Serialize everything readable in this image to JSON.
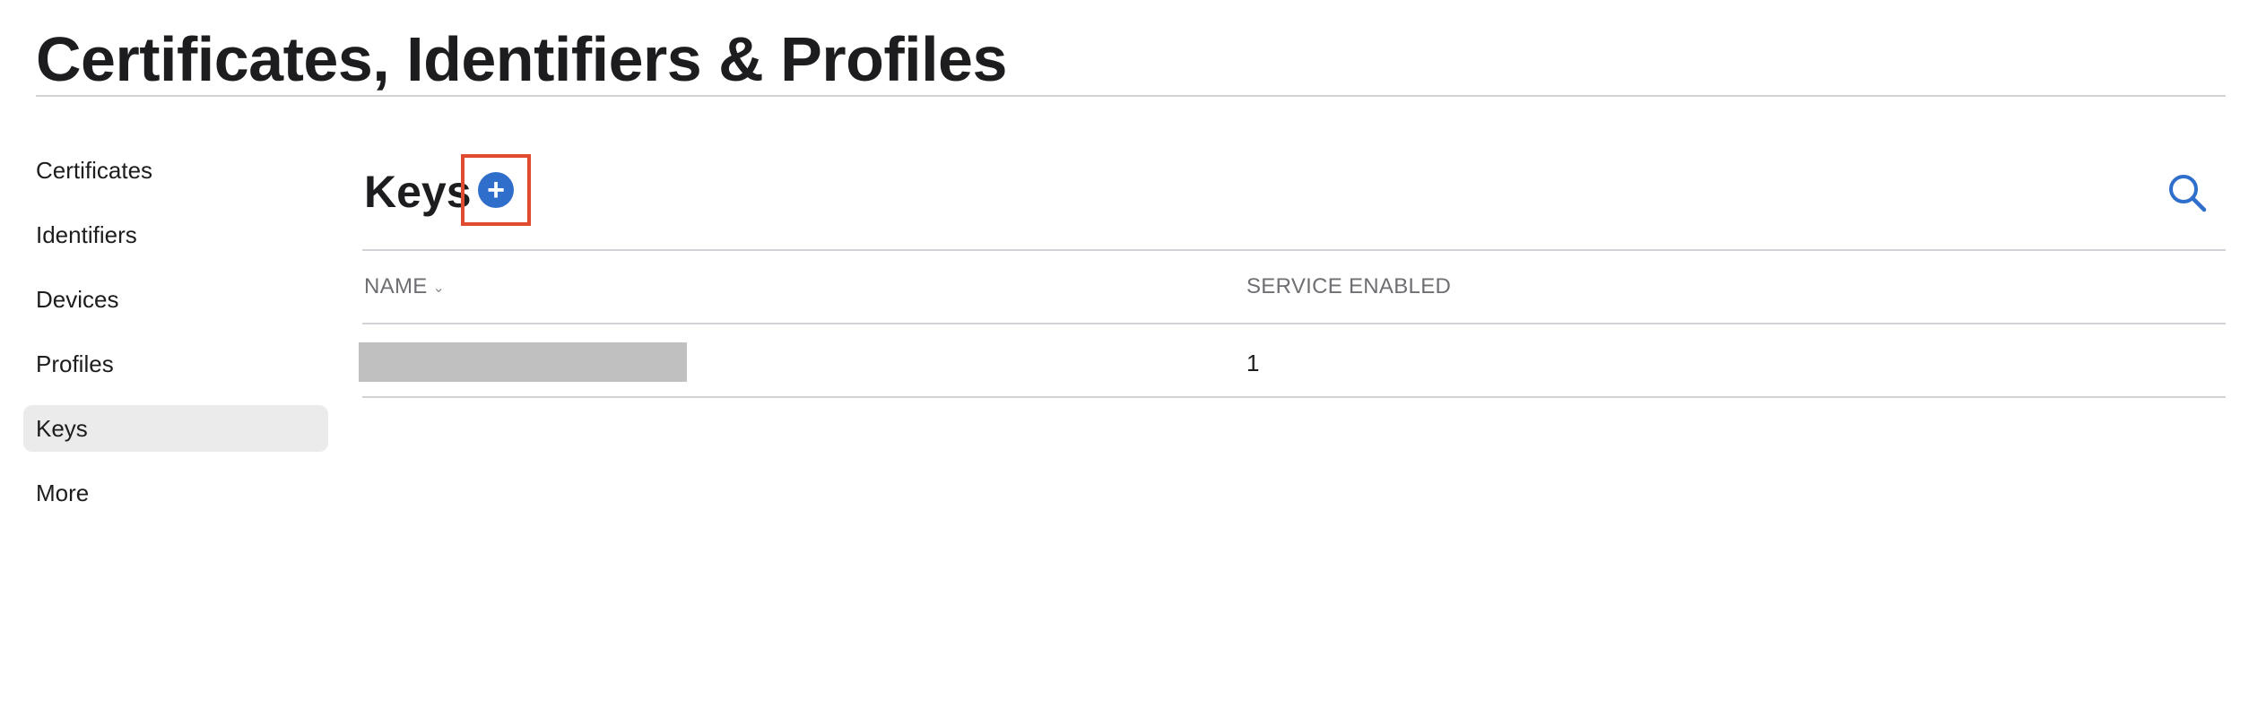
{
  "page": {
    "title": "Certificates, Identifiers & Profiles"
  },
  "sidebar": {
    "items": [
      {
        "label": "Certificates",
        "active": false
      },
      {
        "label": "Identifiers",
        "active": false
      },
      {
        "label": "Devices",
        "active": false
      },
      {
        "label": "Profiles",
        "active": false
      },
      {
        "label": "Keys",
        "active": true
      },
      {
        "label": "More",
        "active": false
      }
    ]
  },
  "main": {
    "section_title": "Keys",
    "add_button_icon": "plus-circle-icon",
    "search_icon": "search-icon",
    "table": {
      "columns": [
        "NAME",
        "SERVICE ENABLED"
      ],
      "sorted_column": "NAME",
      "rows": [
        {
          "name": "",
          "name_redacted": true,
          "service_enabled": "1"
        }
      ]
    }
  },
  "colors": {
    "accent": "#2f6fcb",
    "highlight_frame": "#e04a2f",
    "sidebar_active_bg": "#ebebeb",
    "redaction": "#c0c0c0",
    "divider": "#d2d2d7"
  }
}
